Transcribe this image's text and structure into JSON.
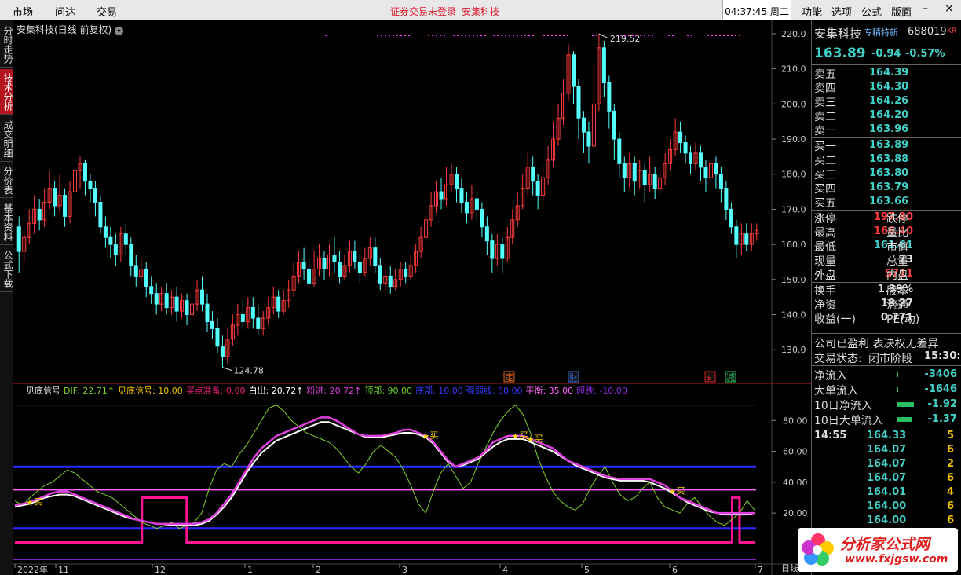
{
  "topbar": {
    "menus": [
      "市场",
      "问达",
      "交易"
    ],
    "notice_left": "证券交易未登录",
    "notice_right": "安集科技",
    "clock": "04:37:45 周二",
    "right_menus": [
      "功能",
      "选项",
      "公式",
      "版面"
    ],
    "win_buttons": [
      "–",
      "×"
    ]
  },
  "leftnav": [
    "分时走势",
    "技术分析",
    "成交明细",
    "分价表",
    "基本资料",
    "公式下载"
  ],
  "chart": {
    "title": "安集科技(日线 前复权)",
    "high_label": "219.52",
    "low_label": "124.78",
    "price_axis": [
      "220.0",
      "210.0",
      "200.0",
      "190.0",
      "180.0",
      "170.0",
      "160.0",
      "150.0",
      "140.0",
      "130.0"
    ],
    "ind_axis": [
      "80.00",
      "60.00",
      "40.00",
      "20.00"
    ],
    "date_axis": [
      "2022年",
      "11",
      "12",
      "1",
      "2",
      "3",
      "4",
      "5",
      "6",
      "7"
    ],
    "period_label": "日线",
    "event_markers": [
      {
        "text": "定",
        "color": "#e06010"
      },
      {
        "text": "财",
        "color": "#3a6ee0"
      },
      {
        "text": "$",
        "color": "#e02020"
      },
      {
        "text": "减",
        "color": "#20c060"
      }
    ],
    "buy_label": "买",
    "legend": [
      {
        "text": "见底信号",
        "color": "#dddddd"
      },
      {
        "text": "DIF: 22.71↑",
        "color": "#7fd02a"
      },
      {
        "text": "见底信号: 10.00",
        "color": "#f0c000"
      },
      {
        "text": "买点准备: 0.00",
        "color": "#e8207a"
      },
      {
        "text": "白出: 20.72↑",
        "color": "#ffffff"
      },
      {
        "text": "粉进: 20.72↑",
        "color": "#e040e0"
      },
      {
        "text": "顶部: 90.00",
        "color": "#6ed02a"
      },
      {
        "text": "底部: 10.00",
        "color": "#3a3aff"
      },
      {
        "text": "强弱线: 50.00",
        "color": "#3a3aff"
      },
      {
        "text": "平衡: 35.00",
        "color": "#ff66ff"
      },
      {
        "text": "超跌: -10.00",
        "color": "#8a2be2"
      }
    ]
  },
  "quote": {
    "name": "安集科技",
    "tag": "专精特新",
    "code": "688019",
    "kr": "KR",
    "price": "163.89",
    "change": "-0.94",
    "pct": "-0.57%",
    "asks": [
      {
        "label": "卖五",
        "price": "164.39"
      },
      {
        "label": "卖四",
        "price": "164.30"
      },
      {
        "label": "卖三",
        "price": "164.26"
      },
      {
        "label": "卖二",
        "price": "164.20"
      },
      {
        "label": "卖一",
        "price": "163.96"
      }
    ],
    "bids": [
      {
        "label": "买一",
        "price": "163.89"
      },
      {
        "label": "买二",
        "price": "163.88"
      },
      {
        "label": "买三",
        "price": "163.80"
      },
      {
        "label": "买四",
        "price": "163.79"
      },
      {
        "label": "买五",
        "price": "163.66"
      }
    ],
    "stats1": [
      {
        "l1": "涨停",
        "v1": "197.80",
        "c1": "#ff3b3b",
        "l2": "跌停"
      },
      {
        "l1": "最高",
        "v1": "166.40",
        "c1": "#ff3b3b",
        "l2": "量比"
      },
      {
        "l1": "最低",
        "v1": "161.61",
        "c1": "#3fd0c8",
        "l2": "市值"
      },
      {
        "l1": "现量",
        "v1": "73",
        "c1": "#dddddd",
        "l2": "总量"
      },
      {
        "l1": "外盘",
        "v1": "5711",
        "c1": "#ff3b3b",
        "l2": "内盘"
      }
    ],
    "stats2": [
      {
        "l1": "换手",
        "v1": "1.39%",
        "l2": "股本"
      },
      {
        "l1": "净资",
        "v1": "18.27",
        "l2": "流通"
      },
      {
        "l1": "收益(一)",
        "v1": "0.771",
        "l2": "PE(动)"
      }
    ],
    "info1": "公司已盈利 表决权无差异",
    "info2_label": "交易状态:",
    "info2_value": "闭市阶段",
    "info2_time": "15:30:",
    "flows": [
      {
        "label": "净流入",
        "value": "-3406"
      },
      {
        "label": "大单流入",
        "value": "-1646"
      },
      {
        "label": "10日净流入",
        "value": "-1.92"
      },
      {
        "label": "10日大单流入",
        "value": "-1.37"
      }
    ],
    "ticks_time": "14:55",
    "ticks": [
      {
        "price": "164.33",
        "vol": "5"
      },
      {
        "price": "164.07",
        "vol": "6"
      },
      {
        "price": "164.07",
        "vol": "2"
      },
      {
        "price": "164.07",
        "vol": "6"
      },
      {
        "price": "164.01",
        "vol": "4"
      },
      {
        "price": "164.00",
        "vol": "6"
      },
      {
        "price": "164.00",
        "vol": "6"
      }
    ]
  },
  "logo": {
    "line1": "分析家公式网",
    "line2": "www.fxjgsw.com"
  },
  "candles": [
    [
      165,
      158,
      168,
      152
    ],
    [
      158,
      162,
      164,
      155
    ],
    [
      162,
      166,
      170,
      160
    ],
    [
      166,
      170,
      174,
      163
    ],
    [
      170,
      167,
      173,
      164
    ],
    [
      167,
      172,
      176,
      165
    ],
    [
      172,
      176,
      181,
      170
    ],
    [
      176,
      171,
      178,
      168
    ],
    [
      171,
      174,
      180,
      169
    ],
    [
      174,
      168,
      176,
      165
    ],
    [
      168,
      175,
      178,
      166
    ],
    [
      175,
      181,
      183,
      172
    ],
    [
      181,
      183,
      185,
      176
    ],
    [
      183,
      178,
      184,
      174
    ],
    [
      178,
      176,
      180,
      172
    ],
    [
      176,
      172,
      178,
      168
    ],
    [
      172,
      165,
      174,
      163
    ],
    [
      165,
      162,
      168,
      159
    ],
    [
      162,
      160,
      165,
      156
    ],
    [
      160,
      157,
      163,
      154
    ],
    [
      157,
      163,
      165,
      155
    ],
    [
      163,
      160,
      166,
      157
    ],
    [
      160,
      154,
      162,
      151
    ],
    [
      154,
      151,
      157,
      148
    ],
    [
      151,
      153,
      156,
      149
    ],
    [
      153,
      148,
      155,
      145
    ],
    [
      148,
      146,
      151,
      143
    ],
    [
      146,
      143,
      149,
      140
    ],
    [
      143,
      146,
      148,
      141
    ],
    [
      146,
      142,
      149,
      140
    ],
    [
      142,
      145,
      147,
      140
    ],
    [
      145,
      141,
      148,
      138
    ],
    [
      141,
      144,
      146,
      139
    ],
    [
      144,
      140,
      146,
      137
    ],
    [
      140,
      143,
      145,
      138
    ],
    [
      143,
      147,
      150,
      141
    ],
    [
      147,
      143,
      151,
      141
    ],
    [
      143,
      138,
      146,
      135
    ],
    [
      138,
      136,
      141,
      133
    ],
    [
      136,
      131,
      139,
      129
    ],
    [
      131,
      128,
      134,
      125
    ],
    [
      128,
      133,
      136,
      126
    ],
    [
      133,
      137,
      140,
      131
    ],
    [
      137,
      140,
      143,
      134
    ],
    [
      140,
      138,
      144,
      136
    ],
    [
      138,
      142,
      145,
      136
    ],
    [
      142,
      139,
      145,
      136
    ],
    [
      139,
      136,
      143,
      134
    ],
    [
      136,
      139,
      141,
      134
    ],
    [
      139,
      142,
      145,
      137
    ],
    [
      142,
      145,
      148,
      140
    ],
    [
      145,
      141,
      147,
      139
    ],
    [
      141,
      144,
      147,
      140
    ],
    [
      144,
      147,
      150,
      142
    ],
    [
      147,
      151,
      155,
      145
    ],
    [
      151,
      155,
      158,
      149
    ],
    [
      155,
      153,
      159,
      150
    ],
    [
      153,
      149,
      156,
      147
    ],
    [
      149,
      153,
      158,
      148
    ],
    [
      153,
      156,
      160,
      151
    ],
    [
      156,
      153,
      158,
      150
    ],
    [
      153,
      157,
      160,
      151
    ],
    [
      157,
      155,
      162,
      152
    ],
    [
      155,
      151,
      158,
      149
    ],
    [
      151,
      154,
      157,
      150
    ],
    [
      154,
      158,
      161,
      152
    ],
    [
      158,
      155,
      161,
      153
    ],
    [
      155,
      152,
      157,
      149
    ],
    [
      152,
      156,
      159,
      151
    ],
    [
      156,
      159,
      162,
      154
    ],
    [
      159,
      154,
      162,
      152
    ],
    [
      154,
      149,
      156,
      147
    ],
    [
      149,
      151,
      153,
      147
    ],
    [
      151,
      148,
      154,
      146
    ],
    [
      148,
      150,
      153,
      147
    ],
    [
      150,
      153,
      155,
      148
    ],
    [
      153,
      151,
      155,
      149
    ],
    [
      151,
      154,
      157,
      150
    ],
    [
      154,
      158,
      160,
      152
    ],
    [
      158,
      162,
      165,
      156
    ],
    [
      162,
      167,
      171,
      160
    ],
    [
      167,
      171,
      175,
      165
    ],
    [
      171,
      175,
      178,
      169
    ],
    [
      175,
      173,
      179,
      170
    ],
    [
      173,
      177,
      182,
      171
    ],
    [
      177,
      180,
      183,
      175
    ],
    [
      180,
      176,
      182,
      172
    ],
    [
      176,
      172,
      179,
      169
    ],
    [
      172,
      169,
      175,
      166
    ],
    [
      169,
      173,
      177,
      167
    ],
    [
      173,
      170,
      175,
      166
    ],
    [
      170,
      165,
      172,
      162
    ],
    [
      165,
      161,
      168,
      157
    ],
    [
      161,
      156,
      163,
      152
    ],
    [
      156,
      160,
      163,
      154
    ],
    [
      160,
      156,
      162,
      152
    ],
    [
      156,
      162,
      165,
      155
    ],
    [
      162,
      167,
      170,
      160
    ],
    [
      167,
      171,
      175,
      165
    ],
    [
      171,
      176,
      180,
      170
    ],
    [
      176,
      182,
      186,
      174
    ],
    [
      182,
      178,
      185,
      174
    ],
    [
      178,
      174,
      180,
      170
    ],
    [
      174,
      179,
      183,
      172
    ],
    [
      179,
      184,
      188,
      177
    ],
    [
      184,
      190,
      195,
      182
    ],
    [
      190,
      196,
      200,
      188
    ],
    [
      196,
      203,
      207,
      194
    ],
    [
      203,
      214,
      217,
      201
    ],
    [
      214,
      205,
      215,
      200
    ],
    [
      205,
      196,
      207,
      190
    ],
    [
      196,
      192,
      198,
      186
    ],
    [
      192,
      188,
      195,
      183
    ],
    [
      188,
      200,
      211,
      187
    ],
    [
      200,
      216,
      220,
      198
    ],
    [
      216,
      206,
      218,
      202
    ],
    [
      206,
      198,
      208,
      193
    ],
    [
      198,
      190,
      200,
      184
    ],
    [
      190,
      183,
      192,
      179
    ],
    [
      183,
      179,
      185,
      175
    ],
    [
      179,
      183,
      186,
      176
    ],
    [
      183,
      178,
      185,
      174
    ],
    [
      178,
      181,
      184,
      176
    ],
    [
      181,
      177,
      183,
      172
    ],
    [
      177,
      180,
      185,
      175
    ],
    [
      180,
      176,
      182,
      173
    ],
    [
      176,
      179,
      181,
      174
    ],
    [
      179,
      183,
      186,
      177
    ],
    [
      183,
      187,
      190,
      181
    ],
    [
      187,
      192,
      196,
      185
    ],
    [
      192,
      189,
      195,
      186
    ],
    [
      189,
      186,
      191,
      183
    ],
    [
      186,
      183,
      188,
      180
    ],
    [
      183,
      186,
      189,
      181
    ],
    [
      186,
      182,
      188,
      178
    ],
    [
      182,
      179,
      184,
      175
    ],
    [
      179,
      183,
      186,
      177
    ],
    [
      183,
      180,
      185,
      176
    ],
    [
      180,
      176,
      182,
      172
    ],
    [
      176,
      170,
      178,
      167
    ],
    [
      170,
      165,
      172,
      163
    ],
    [
      165,
      160,
      167,
      156
    ],
    [
      160,
      163,
      166,
      157
    ],
    [
      163,
      160,
      166,
      158
    ],
    [
      160,
      163,
      166,
      158
    ],
    [
      163,
      164,
      166,
      161
    ]
  ],
  "dif": [
    28,
    25,
    30,
    34,
    38,
    40,
    44,
    48,
    46,
    42,
    38,
    34,
    32,
    30,
    26,
    22,
    18,
    14,
    12,
    10,
    12,
    14,
    10,
    12,
    14,
    20,
    36,
    48,
    52,
    50,
    58,
    64,
    72,
    80,
    88,
    90,
    86,
    80,
    76,
    72,
    70,
    68,
    66,
    62,
    56,
    50,
    46,
    52,
    60,
    64,
    60,
    56,
    48,
    38,
    26,
    20,
    34,
    46,
    52,
    44,
    36,
    40,
    52,
    62,
    72,
    80,
    86,
    90,
    84,
    72,
    56,
    44,
    34,
    28,
    24,
    22,
    26,
    36,
    44,
    50,
    40,
    32,
    28,
    30,
    36,
    40,
    30,
    24,
    22,
    20,
    26,
    30,
    24,
    18,
    14,
    12,
    16,
    20,
    28,
    22
  ],
  "pink": [
    25,
    26,
    27,
    29,
    31,
    33,
    34,
    34,
    32,
    30,
    28,
    26,
    24,
    22,
    20,
    18,
    16,
    15,
    14,
    13,
    13,
    13,
    13,
    13,
    13,
    14,
    16,
    20,
    26,
    32,
    40,
    48,
    56,
    62,
    66,
    70,
    72,
    74,
    76,
    78,
    80,
    82,
    82,
    80,
    77,
    74,
    71,
    70,
    70,
    70,
    71,
    72,
    74,
    74,
    72,
    70,
    66,
    60,
    54,
    50,
    52,
    54,
    56,
    60,
    66,
    68,
    70,
    70,
    70,
    68,
    66,
    64,
    62,
    58,
    54,
    52,
    50,
    48,
    46,
    44,
    43,
    42,
    42,
    42,
    42,
    42,
    40,
    38,
    34,
    30,
    28,
    26,
    24,
    22,
    20,
    20,
    20,
    20,
    20,
    20
  ],
  "white": [
    24,
    25,
    26,
    28,
    30,
    31,
    32,
    32,
    31,
    29,
    27,
    25,
    23,
    21,
    19,
    17,
    16,
    15,
    14,
    13,
    13,
    12,
    12,
    12,
    12,
    13,
    15,
    19,
    24,
    30,
    38,
    46,
    53,
    59,
    63,
    67,
    69,
    71,
    73,
    75,
    77,
    79,
    79,
    77,
    75,
    73,
    71,
    69,
    69,
    69,
    70,
    71,
    72,
    72,
    71,
    69,
    65,
    59,
    53,
    50,
    51,
    53,
    55,
    59,
    63,
    66,
    68,
    68,
    68,
    66,
    64,
    62,
    60,
    57,
    54,
    51,
    49,
    47,
    45,
    43,
    42,
    41,
    41,
    41,
    41,
    40,
    38,
    36,
    33,
    30,
    27,
    25,
    23,
    21,
    20,
    19,
    19,
    19,
    19,
    20
  ],
  "buy_signal": [
    0,
    0,
    0,
    0,
    0,
    0,
    0,
    0,
    0,
    0,
    0,
    0,
    0,
    0,
    0,
    0,
    0,
    1,
    1,
    1,
    1,
    1,
    1,
    0,
    0,
    0,
    0,
    0,
    0,
    0,
    0,
    0,
    0,
    0,
    0,
    0,
    0,
    0,
    0,
    0,
    0,
    0,
    0,
    0,
    0,
    0,
    0,
    0,
    0,
    0,
    0,
    0,
    0,
    0,
    0,
    0,
    0,
    0,
    0,
    0,
    0,
    0,
    0,
    0,
    0,
    0,
    0,
    0,
    0,
    0,
    0,
    0,
    0,
    0,
    0,
    0,
    0,
    0,
    0,
    0,
    0,
    0,
    0,
    0,
    0,
    0,
    0,
    0,
    0,
    0,
    0,
    0,
    0,
    0,
    0,
    0,
    1,
    0,
    0,
    0
  ],
  "buy_points": [
    2,
    55,
    67,
    69,
    88
  ]
}
